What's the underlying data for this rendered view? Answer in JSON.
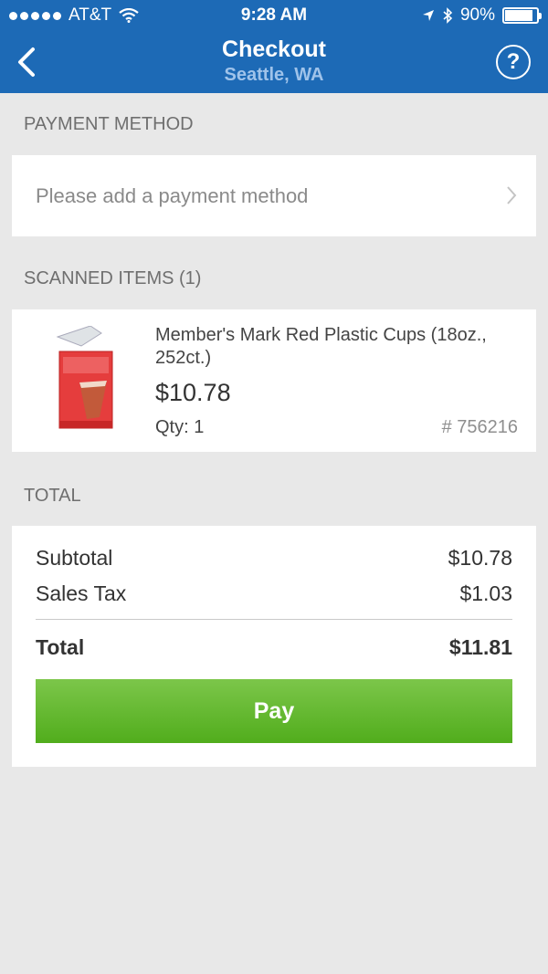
{
  "status_bar": {
    "carrier": "AT&T",
    "time": "9:28 AM",
    "battery": "90%",
    "battery_level": 0.9
  },
  "nav": {
    "title": "Checkout",
    "subtitle": "Seattle, WA",
    "help_label": "?"
  },
  "payment": {
    "section_label": "PAYMENT METHOD",
    "placeholder": "Please add a payment method"
  },
  "scanned": {
    "section_label": "SCANNED ITEMS (1)",
    "items": [
      {
        "name": "Member's Mark Red Plastic Cups (18oz., 252ct.)",
        "price": "$10.78",
        "qty": "Qty: 1",
        "sku": "# 756216"
      }
    ]
  },
  "total": {
    "section_label": "TOTAL",
    "subtotal_label": "Subtotal",
    "subtotal_value": "$10.78",
    "tax_label": "Sales Tax",
    "tax_value": "$1.03",
    "total_label": "Total",
    "total_value": "$11.81",
    "pay_label": "Pay"
  },
  "colors": {
    "header": "#1d6ab6",
    "pay_button": "#5cb82a"
  },
  "icons": [
    "back-chevron-icon",
    "help-icon",
    "wifi-icon",
    "location-arrow-icon",
    "bluetooth-icon",
    "battery-icon",
    "chevron-right-icon"
  ]
}
